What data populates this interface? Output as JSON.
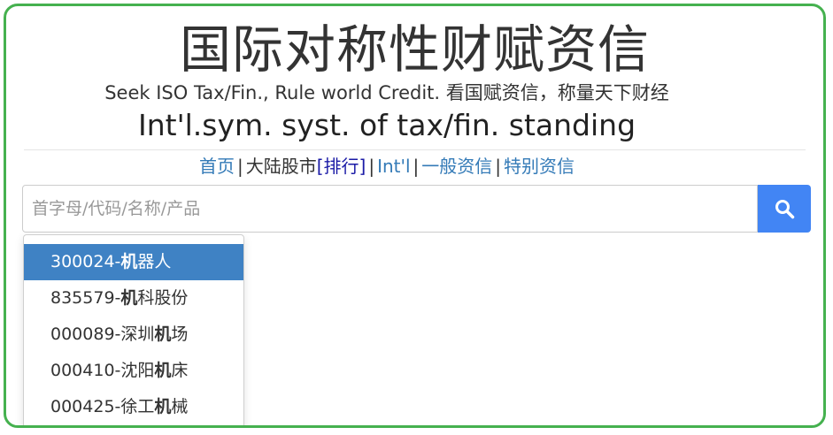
{
  "header": {
    "title": "国际对称性财赋资信",
    "subtitle": "Seek ISO Tax/Fin., Rule world Credit. 看国赋资信，称量天下财经",
    "standing": "Int'l.sym. syst. of tax/fin. standing"
  },
  "nav": {
    "home": "首页",
    "mainland": "大陆股市",
    "ranking": "[排行]",
    "intl": "Int'l",
    "general": "一般资信",
    "special": "特别资信",
    "separator": "|"
  },
  "search": {
    "placeholder": "首字母/代码/名称/产品",
    "value": "",
    "button_icon": "search-icon"
  },
  "suggestions": [
    {
      "code": "300024-",
      "match": "机",
      "rest": "器人",
      "prefix": ""
    },
    {
      "code": "835579-",
      "match": "机",
      "rest": "科股份",
      "prefix": ""
    },
    {
      "code": "000089-",
      "prefix": "深圳",
      "match": "机",
      "rest": "场"
    },
    {
      "code": "000410-",
      "prefix": "沈阳",
      "match": "机",
      "rest": "床"
    },
    {
      "code": "000425-",
      "prefix": "徐工",
      "match": "机",
      "rest": "械"
    }
  ],
  "colors": {
    "frame_border": "#45b14f",
    "link": "#337ab7",
    "search_button": "#4285f4",
    "active_item": "#3f82c4"
  }
}
